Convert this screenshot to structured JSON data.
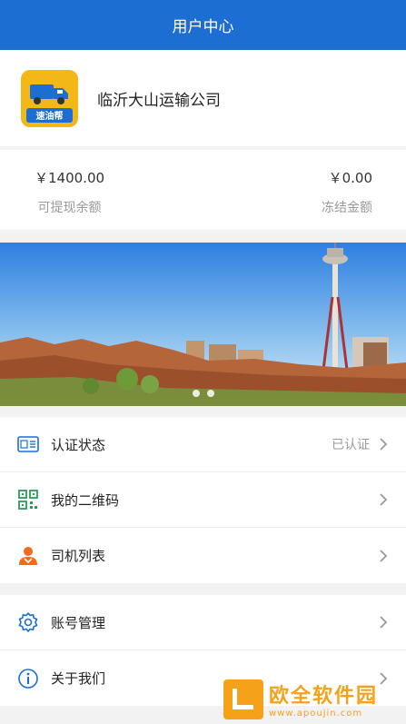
{
  "header": {
    "title": "用户中心"
  },
  "profile": {
    "company_name": "临沂大山运输公司",
    "logo_text": "速油帮"
  },
  "balance": {
    "withdrawable_amount": "￥1400.00",
    "withdrawable_label": "可提现余额",
    "frozen_amount": "￥0.00",
    "frozen_label": "冻结金额"
  },
  "banner": {
    "slide_count": 2,
    "active_slide": 1
  },
  "menu": {
    "group1": [
      {
        "label": "认证状态",
        "value": "已认证",
        "icon": "id-card-icon"
      },
      {
        "label": "我的二维码",
        "value": "",
        "icon": "qr-code-icon"
      },
      {
        "label": "司机列表",
        "value": "",
        "icon": "driver-icon"
      }
    ],
    "group2": [
      {
        "label": "账号管理",
        "value": "",
        "icon": "gear-icon"
      },
      {
        "label": "关于我们",
        "value": "",
        "icon": "info-icon"
      }
    ]
  },
  "watermark": {
    "title": "欧全软件园",
    "url": "www.apoujin.com"
  },
  "colors": {
    "primary": "#1c6ed3",
    "accent": "#f3b718",
    "driver_icon": "#f26b1d",
    "watermark": "#f5a21a"
  }
}
